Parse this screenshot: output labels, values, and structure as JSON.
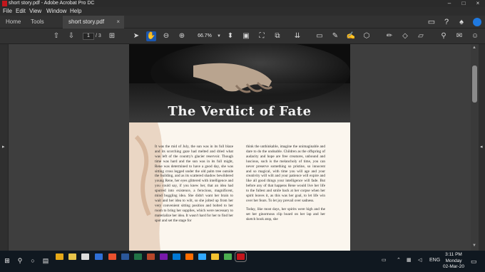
{
  "window": {
    "title": "short story.pdf - Adobe Acrobat Pro DC"
  },
  "menu": [
    "File",
    "Edit",
    "View",
    "Window",
    "Help"
  ],
  "tabs": {
    "home": "Home",
    "tools": "Tools",
    "document": "short story.pdf"
  },
  "toolbar": {
    "current_page": "1",
    "total_pages": "/ 3",
    "zoom": "66.7%"
  },
  "document": {
    "title": "The Verdict of Fate",
    "col1": "It was the mid of July, the sun was in its full blaze and its scorching gaze had melted and dried what was left of the country's glacier reservoir. Though time was hard and the sun was in its full might, Rene was determined to have a good day, she was sitting cross legged under the old palm tree outside the building, and as its scattered shadow bewildered young Rene, her eyes glittered with intelligence and you could say, if you knew her, that an idea had spurred into existence, a ferocious, magnificent, mind boggling idea. She didn't want her brain to wait and her idea to wilt, so she jolted up from her very convenient sitting position and bolted to her room to bring her supplies, which were necessary to materialize her idea. It wasn't hard for her to find her spot and set the stage for",
    "col2": "think the unthinkable, imagine the unimaginable and dare to do the undoable. Children as the offspring of audacity and hope are free creatures, unbound and luscious, such is the melancholy of time, you can never preserve something so pristine, so innocent and so magical, with time you will age and your creativity will wilt and your patience will expire and like all good things your intelligence will fade. But before any of that happens Rene would live her life to the fullest and smile back at her corpse when her spirit leaves it, as this was her goal, to let life win over her fears. To let joy prevail over sadness.",
    "col2b": "Today, like most days, her spirits were high and the set her ginormous clip board on her lap and her sketch book atop, she"
  },
  "taskbar": {
    "lang": "ENG",
    "time": "3:11 PM",
    "day": "Monday",
    "date": "02-Mar-20"
  },
  "colors": {
    "accent": "#1b57b0",
    "acrobat_red": "#c4161c"
  }
}
